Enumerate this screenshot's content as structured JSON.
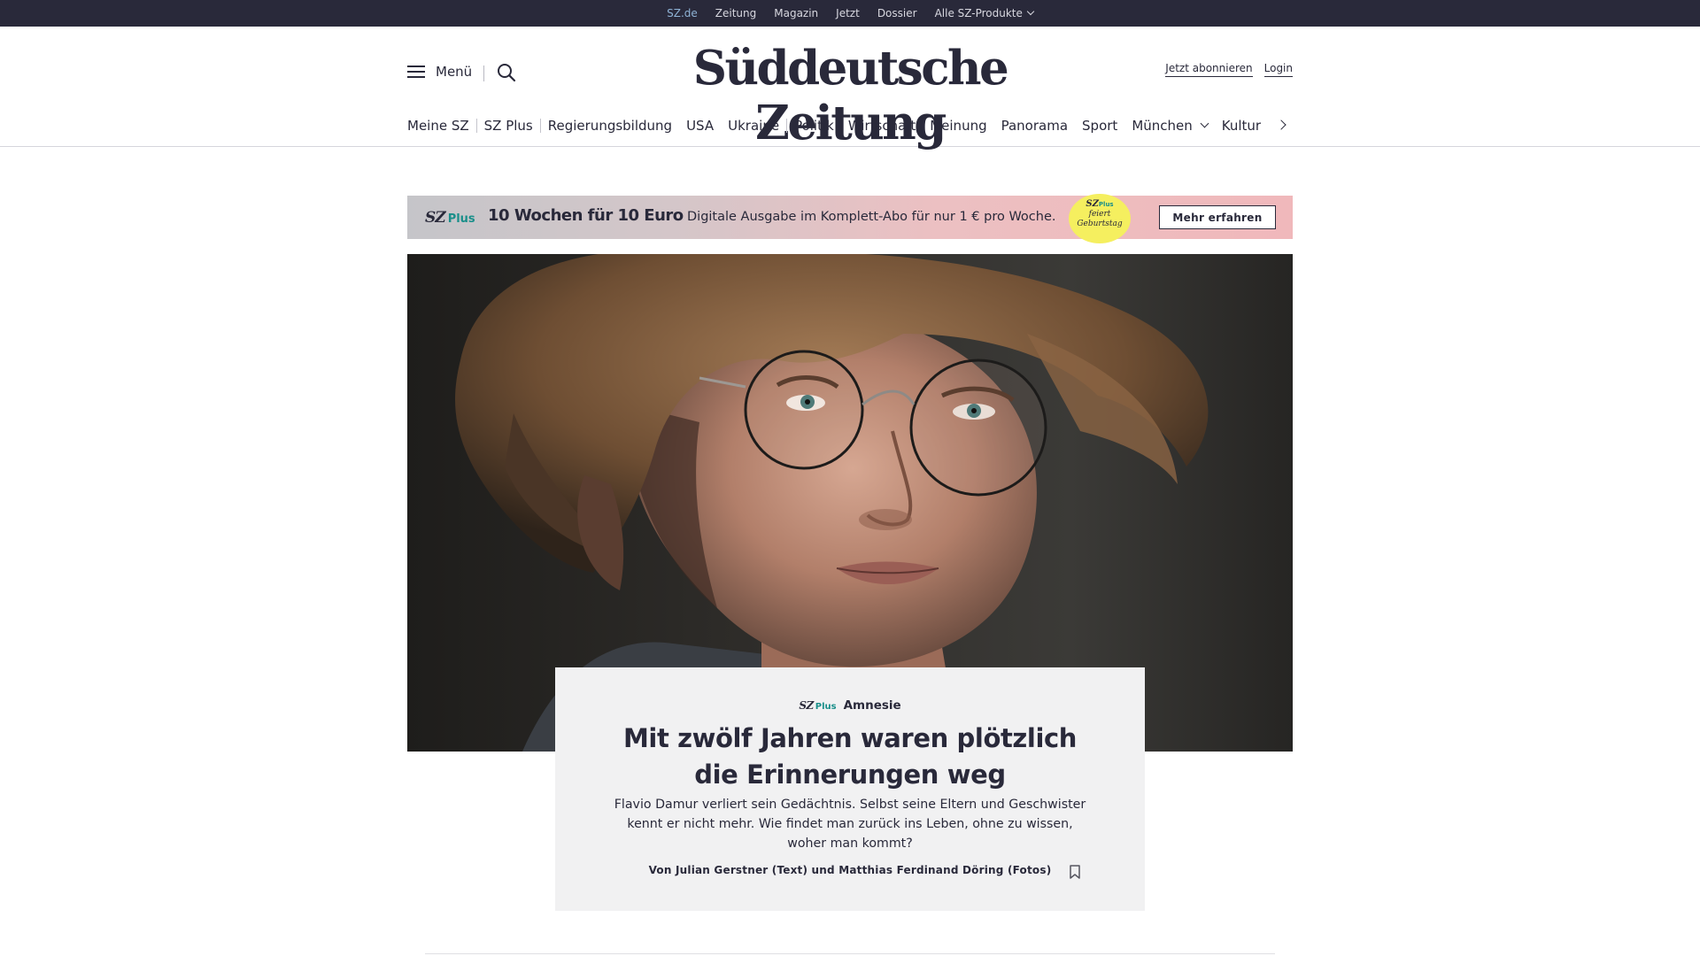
{
  "topbar": {
    "items": [
      {
        "label": "SZ.de",
        "active": true
      },
      {
        "label": "Zeitung"
      },
      {
        "label": "Magazin"
      },
      {
        "label": "Jetzt"
      },
      {
        "label": "Dossier"
      },
      {
        "label": "Alle SZ-Produkte",
        "has_dropdown": true
      }
    ]
  },
  "header": {
    "menu_label": "Menü",
    "logo": "Süddeutsche Zeitung",
    "subscribe_label": "Jetzt abonnieren",
    "login_label": "Login"
  },
  "nav": {
    "items": [
      {
        "label": "Meine SZ"
      },
      {
        "label": "SZ Plus"
      },
      {
        "label": "Regierungsbildung"
      },
      {
        "label": "USA"
      },
      {
        "label": "Ukraine"
      },
      {
        "label": "Politik"
      },
      {
        "label": "Wirtschaft"
      },
      {
        "label": "Meinung"
      },
      {
        "label": "Panorama"
      },
      {
        "label": "Sport"
      },
      {
        "label": "München",
        "has_dropdown": true
      },
      {
        "label": "Kultur"
      }
    ]
  },
  "promo": {
    "logo_sz": "SZ",
    "logo_plus": "Plus",
    "headline": "10 Wochen für 10 Euro",
    "text": "Digitale Ausgabe im Komplett-Abo für nur 1 € pro Woche.",
    "badge_sz": "SZ",
    "badge_plus": "Plus",
    "badge_line1": "feiert",
    "badge_line2": "Geburtstag",
    "button_label": "Mehr erfahren"
  },
  "article": {
    "kicker_sz": "SZ",
    "kicker_plus": "Plus",
    "kicker": "Amnesie",
    "headline_line1": "Mit zwölf Jahren waren plötzlich",
    "headline_line2": "die Erinnerungen weg",
    "teaser": "Flavio Damur verliert sein Gedächtnis. Selbst seine Eltern und Geschwister kennt er nicht mehr. Wie findet man zurück ins Leben, ohne zu wissen, woher man kommt?",
    "byline": "Von Julian Gerstner (Text) und Matthias Ferdinand Döring (Fotos)"
  },
  "colors": {
    "brand_dark": "#29293a",
    "plus_teal": "#1a8f8a",
    "active_topbar": "#8fb3d6",
    "badge_yellow": "#f5ef5f",
    "card_bg": "#f1f1f2"
  }
}
